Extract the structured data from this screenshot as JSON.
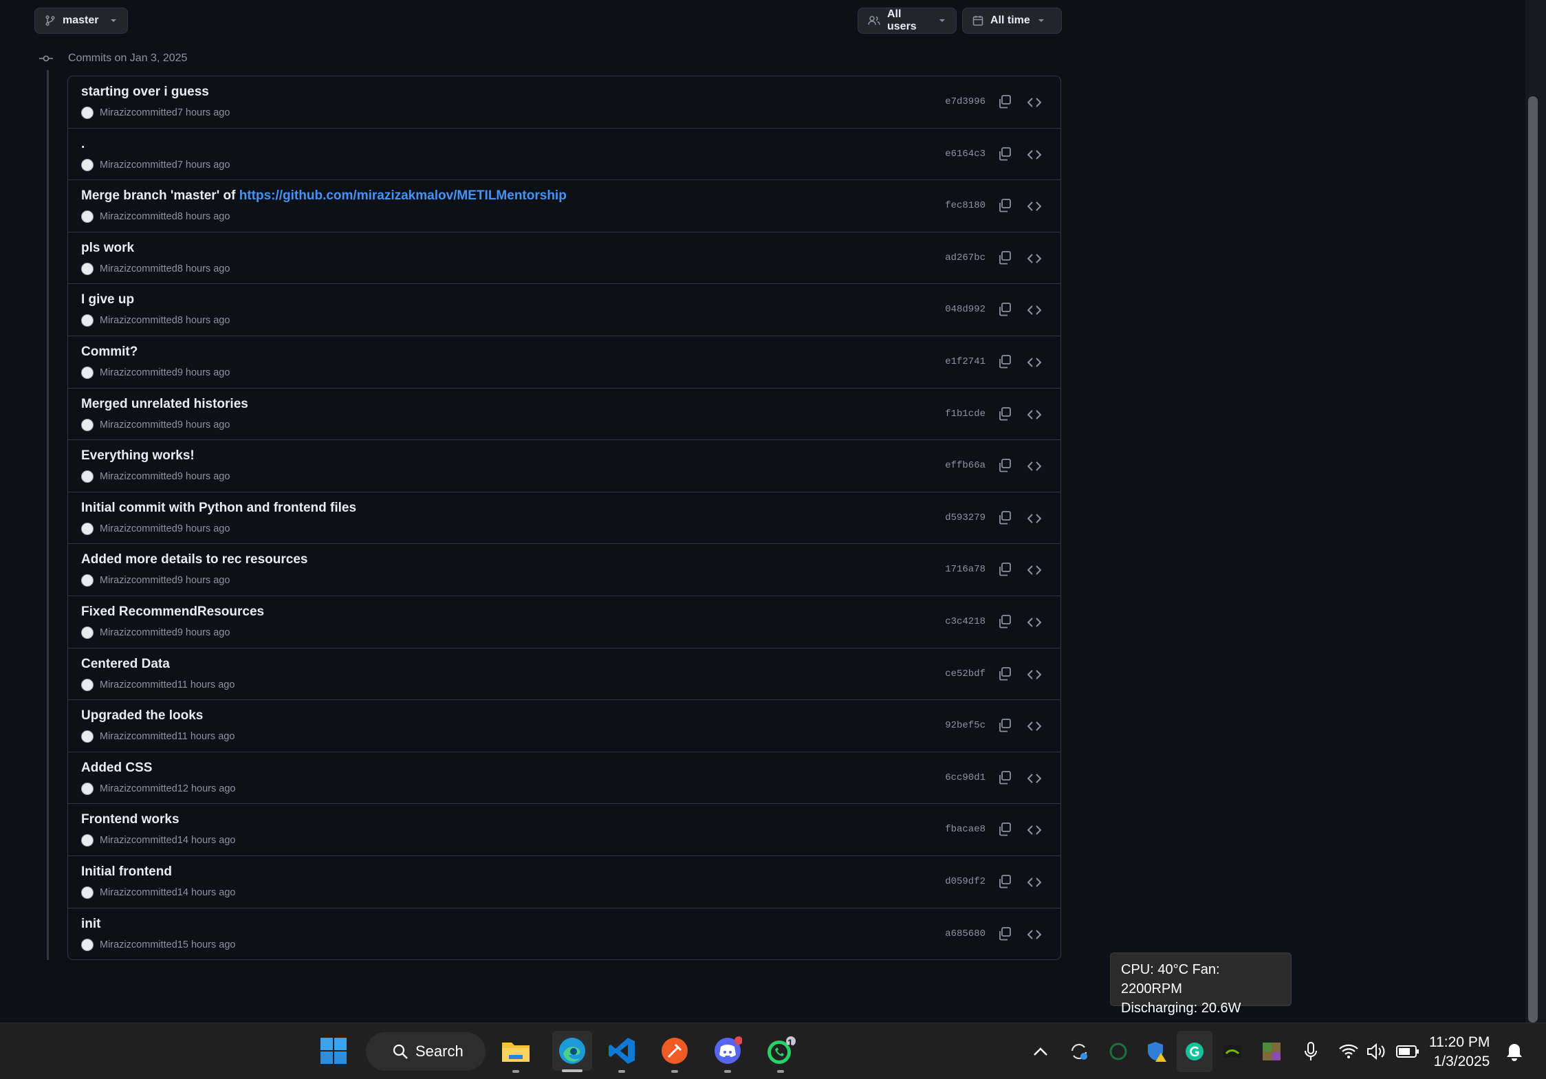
{
  "toolbar": {
    "branch": "master",
    "users_filter": "All users",
    "time_filter": "All time"
  },
  "group_header": "Commits on Jan 3, 2025",
  "commits": [
    {
      "message": "starting over i guess",
      "author": "Miraziz",
      "action": "committed",
      "time": "7 hours ago",
      "sha": "e7d3996"
    },
    {
      "message": ".",
      "author": "Miraziz",
      "action": "committed",
      "time": "7 hours ago",
      "sha": "e6164c3"
    },
    {
      "message": "Merge branch 'master' of ",
      "link": "https://github.com/mirazizakmalov/METILMentorship",
      "author": "Miraziz",
      "action": "committed",
      "time": "8 hours ago",
      "sha": "fec8180"
    },
    {
      "message": "pls work",
      "author": "Miraziz",
      "action": "committed",
      "time": "8 hours ago",
      "sha": "ad267bc"
    },
    {
      "message": "I give up",
      "author": "Miraziz",
      "action": "committed",
      "time": "8 hours ago",
      "sha": "048d992"
    },
    {
      "message": "Commit?",
      "author": "Miraziz",
      "action": "committed",
      "time": "9 hours ago",
      "sha": "e1f2741"
    },
    {
      "message": "Merged unrelated histories",
      "author": "Miraziz",
      "action": "committed",
      "time": "9 hours ago",
      "sha": "f1b1cde"
    },
    {
      "message": "Everything works!",
      "author": "Miraziz",
      "action": "committed",
      "time": "9 hours ago",
      "sha": "effb66a"
    },
    {
      "message": "Initial commit with Python and frontend files",
      "author": "Miraziz",
      "action": "committed",
      "time": "9 hours ago",
      "sha": "d593279"
    },
    {
      "message": "Added more details to rec resources",
      "author": "Miraziz",
      "action": "committed",
      "time": "9 hours ago",
      "sha": "1716a78"
    },
    {
      "message": "Fixed RecommendResources",
      "author": "Miraziz",
      "action": "committed",
      "time": "9 hours ago",
      "sha": "c3c4218"
    },
    {
      "message": "Centered Data",
      "author": "Miraziz",
      "action": "committed",
      "time": "11 hours ago",
      "sha": "ce52bdf"
    },
    {
      "message": "Upgraded the looks",
      "author": "Miraziz",
      "action": "committed",
      "time": "11 hours ago",
      "sha": "92bef5c"
    },
    {
      "message": "Added CSS",
      "author": "Miraziz",
      "action": "committed",
      "time": "12 hours ago",
      "sha": "6cc90d1"
    },
    {
      "message": "Frontend works",
      "author": "Miraziz",
      "action": "committed",
      "time": "14 hours ago",
      "sha": "fbacae8"
    },
    {
      "message": "Initial frontend",
      "author": "Miraziz",
      "action": "committed",
      "time": "14 hours ago",
      "sha": "d059df2"
    },
    {
      "message": "init",
      "author": "Miraziz",
      "action": "committed",
      "time": "15 hours ago",
      "sha": "a685680"
    }
  ],
  "tooltip": {
    "line1": "CPU: 40°C Fan: 2200RPM",
    "line2": "Discharging: 20.6W"
  },
  "taskbar": {
    "search_label": "Search",
    "apps": [
      "start-icon",
      "file-explorer-icon",
      "edge-icon",
      "vscode-icon",
      "postman-icon",
      "discord-icon",
      "whatsapp-icon"
    ],
    "whatsapp_badge": "1",
    "clock_time": "11:20 PM",
    "clock_date": "1/3/2025"
  },
  "colors": {
    "background": "#0d1117",
    "border": "#30363d",
    "link": "#4493f8",
    "muted": "#8b949e"
  }
}
